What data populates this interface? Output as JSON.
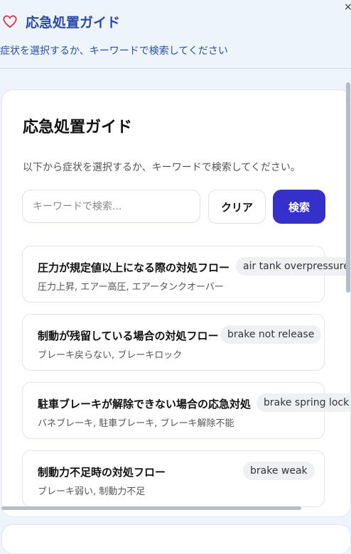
{
  "header": {
    "title": "応急処置ガイド",
    "subtitle": "症状を選択するか、キーワードで検索してください",
    "close_label": "×",
    "icon": "heart-icon"
  },
  "panel": {
    "title": "応急処置ガイド",
    "description": "以下から症状を選択するか、キーワードで検索してください。"
  },
  "search": {
    "placeholder": "キーワードで検索...",
    "value": "",
    "clear_label": "クリア",
    "search_label": "検索"
  },
  "items": [
    {
      "title": "圧力が規定値以上になる際の対処フロー",
      "tag": "air tank overpressure",
      "keywords": "圧力上昇, エアー高圧, エアータンクオーバー"
    },
    {
      "title": "制動が残留している場合の対処フロー",
      "tag": "brake not release",
      "keywords": "ブレーキ戻らない, ブレーキロック"
    },
    {
      "title": "駐車ブレーキが解除できない場合の応急対処",
      "tag": "brake spring lock",
      "keywords": "バネブレーキ, 駐車ブレーキ, ブレーキ解除不能"
    },
    {
      "title": "制動力不足時の対処フロー",
      "tag": "brake weak",
      "keywords": "ブレーキ弱い, 制動力不足"
    }
  ],
  "colors": {
    "accent": "#3530c9",
    "header_text": "#2a4aa8",
    "heart": "#d6455a",
    "background": "#eef4fc"
  }
}
